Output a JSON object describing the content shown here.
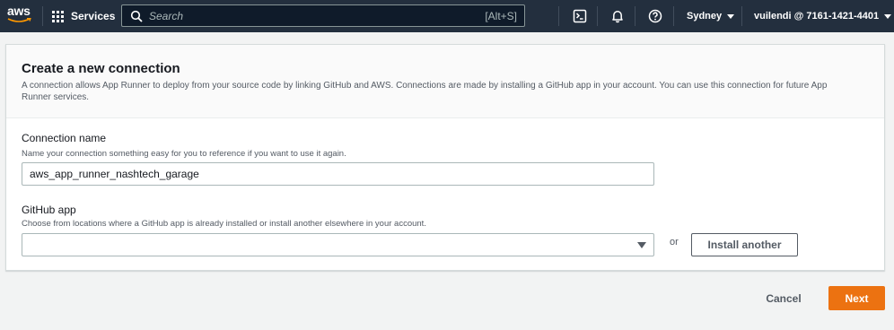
{
  "nav": {
    "logo_text": "aws",
    "services_label": "Services",
    "search_placeholder": "Search",
    "search_shortcut": "[Alt+S]",
    "region_label": "Sydney",
    "account_label": "vuilendi @ 7161-1421-4401"
  },
  "panel": {
    "title": "Create a new connection",
    "description": "A connection allows App Runner to deploy from your source code by linking GitHub and AWS. Connections are made by installing a GitHub app in your account. You can use this connection for future App Runner services."
  },
  "connection_name": {
    "label": "Connection name",
    "description": "Name your connection something easy for you to reference if you want to use it again.",
    "value": "aws_app_runner_nashtech_garage"
  },
  "github_app": {
    "label": "GitHub app",
    "description": "Choose from locations where a GitHub app is already installed or install another elsewhere in your account.",
    "selected": "",
    "or_text": "or",
    "install_another_label": "Install another"
  },
  "footer": {
    "cancel_label": "Cancel",
    "next_label": "Next"
  },
  "colors": {
    "nav_bg": "#232f3e",
    "primary": "#ec7211",
    "page_bg": "#f2f3f3"
  }
}
